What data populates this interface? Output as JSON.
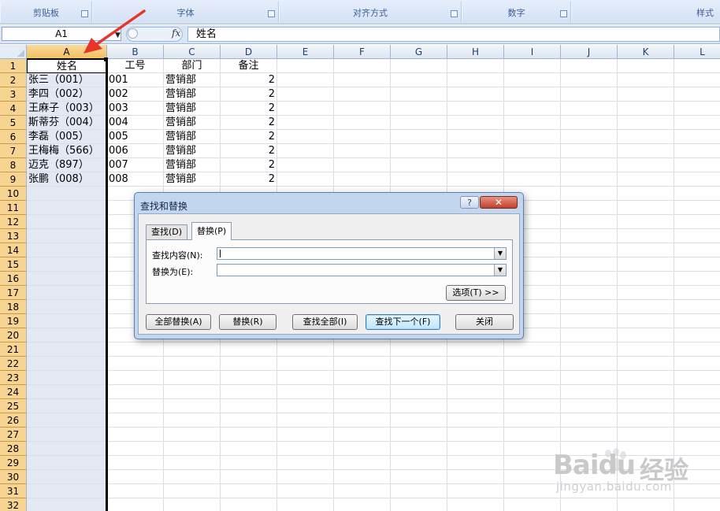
{
  "ribbon": {
    "groups": [
      {
        "label": "剪贴板"
      },
      {
        "label": "字体"
      },
      {
        "label": "对齐方式"
      },
      {
        "label": "数字"
      },
      {
        "label": "样式"
      }
    ]
  },
  "formula_bar": {
    "name_box": "A1",
    "fx": "fx",
    "content": "姓名"
  },
  "columns": [
    "A",
    "B",
    "C",
    "D",
    "E",
    "F",
    "G",
    "H",
    "I",
    "J",
    "K",
    "L"
  ],
  "rows": [
    "1",
    "2",
    "3",
    "4",
    "5",
    "6",
    "7",
    "8",
    "9",
    "10",
    "11",
    "12",
    "13",
    "14",
    "15",
    "16",
    "17",
    "18",
    "19",
    "20",
    "21",
    "22",
    "23",
    "24",
    "25",
    "26",
    "27",
    "28",
    "29",
    "30",
    "31",
    "32"
  ],
  "table": {
    "header": [
      "姓名",
      "工号",
      "部门",
      "备注"
    ],
    "data": [
      [
        "张三（001）",
        "001",
        "营销部",
        "2"
      ],
      [
        "李四（002）",
        "002",
        "营销部",
        "2"
      ],
      [
        "王麻子（003）",
        "003",
        "营销部",
        "2"
      ],
      [
        "斯蒂芬（004）",
        "004",
        "营销部",
        "2"
      ],
      [
        "李磊（005）",
        "005",
        "营销部",
        "2"
      ],
      [
        "王梅梅（566）",
        "006",
        "营销部",
        "2"
      ],
      [
        "迈克（897）",
        "007",
        "营销部",
        "2"
      ],
      [
        "张鹏（008）",
        "008",
        "营销部",
        "2"
      ]
    ]
  },
  "dialog": {
    "title": "查找和替换",
    "help": "?",
    "close": "✕",
    "tabs": [
      "查找(D)",
      "替换(P)"
    ],
    "find_label": "查找内容(N):",
    "find_value": "",
    "replace_label": "替换为(E):",
    "replace_value": "",
    "options_button": "选项(T) >>",
    "buttons": [
      "全部替换(A)",
      "替换(R)",
      "查找全部(I)",
      "查找下一个(F)",
      "关闭"
    ]
  },
  "watermark": {
    "brand": "Baidu",
    "brand_cn": "经验",
    "url": "jingyan.baidu.com"
  },
  "colors": {
    "annotation_arrow": "#e8352c",
    "selected_column": "#e3e8f3",
    "row_header": "#f8d493"
  }
}
